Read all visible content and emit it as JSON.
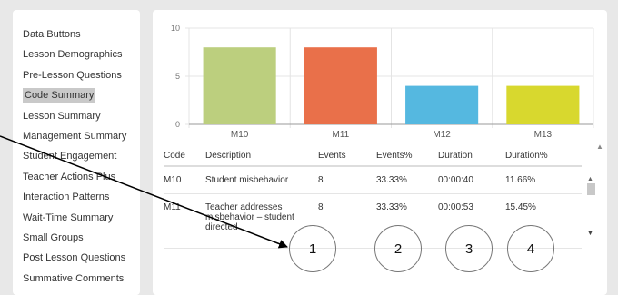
{
  "sidebar": {
    "items": [
      {
        "label": "Data Buttons"
      },
      {
        "label": "Lesson Demographics"
      },
      {
        "label": "Pre-Lesson Questions"
      },
      {
        "label": "Code Summary",
        "active": true
      },
      {
        "label": "Lesson Summary"
      },
      {
        "label": "Management Summary"
      },
      {
        "label": "Student Engagement"
      },
      {
        "label": "Teacher Actions Plus"
      },
      {
        "label": "Interaction Patterns"
      },
      {
        "label": "Wait-Time Summary"
      },
      {
        "label": "Small Groups"
      },
      {
        "label": "Post Lesson Questions"
      },
      {
        "label": "Summative Comments"
      }
    ]
  },
  "chart_data": {
    "type": "bar",
    "categories": [
      "M10",
      "M11",
      "M12",
      "M13"
    ],
    "values": [
      8,
      8,
      4,
      4
    ],
    "colors": [
      "#bccf7e",
      "#e9704a",
      "#55b8e0",
      "#d8d82e"
    ],
    "ylim": [
      0,
      10
    ],
    "yticks": [
      "0",
      "5",
      "10"
    ],
    "grid": true
  },
  "table": {
    "headers": [
      "Code",
      "Description",
      "Events",
      "Events%",
      "Duration",
      "Duration%"
    ],
    "rows": [
      [
        "M10",
        "Student misbehavior",
        "8",
        "33.33%",
        "00:00:40",
        "11.66%"
      ],
      [
        "M11",
        "Teacher addresses misbehavior – student directed",
        "8",
        "33.33%",
        "00:00:53",
        "15.45%"
      ]
    ]
  },
  "annotations": [
    "1",
    "2",
    "3",
    "4"
  ]
}
